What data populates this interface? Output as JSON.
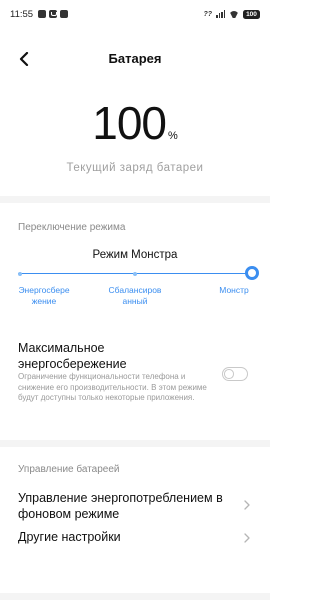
{
  "status_bar": {
    "time": "11:55",
    "left_icons": [
      "notification-icon",
      "message-icon",
      "media-icon"
    ],
    "network_text": "??",
    "battery_level": "100"
  },
  "header": {
    "title": "Батарея",
    "back_icon": "back-arrow-icon"
  },
  "charge": {
    "value": "100",
    "unit": "%",
    "label": "Текущий заряд батареи"
  },
  "mode_switch": {
    "section_title": "Переключение режима",
    "current_mode": "Режим Монстра",
    "modes": [
      {
        "label": "Энергосбере\nжение"
      },
      {
        "label": "Сбалансиров\nанный"
      },
      {
        "label": "Монстр"
      }
    ],
    "selected_index": 2,
    "slider_fraction": 1.0,
    "accent_color": "#3b8ef0"
  },
  "power_saving": {
    "title": "Максимальное энергосбережение",
    "description": "Ограничение функциональности телефона и снижение его производительности. В этом режиме будут доступны только некоторые приложения.",
    "enabled": false
  },
  "battery_management": {
    "section_title": "Управление батареей",
    "items": [
      {
        "label": "Управление энергопотреблением в фоновом режиме",
        "icon": "chevron-right-icon"
      },
      {
        "label": "Другие настройки",
        "icon": "chevron-right-icon"
      }
    ]
  }
}
